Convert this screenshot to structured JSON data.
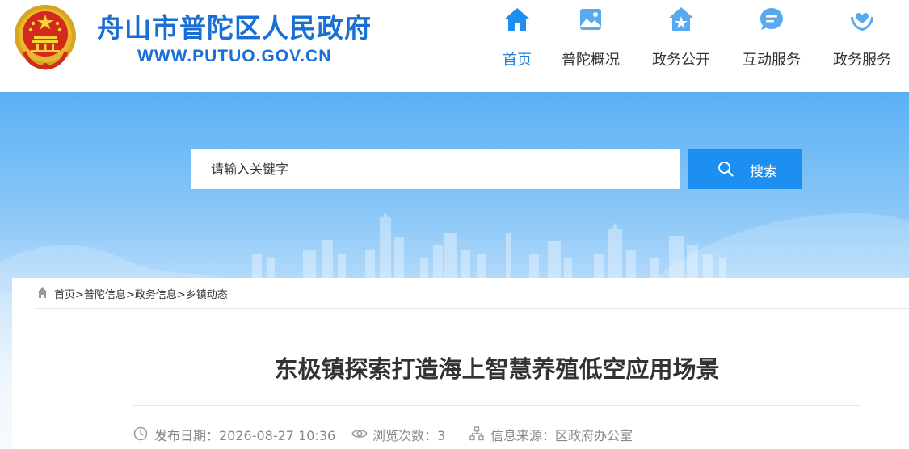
{
  "header": {
    "site_title": "舟山市普陀区人民政府",
    "site_url": "WWW.PUTUO.GOV.CN"
  },
  "nav": {
    "items": [
      {
        "label": "首页",
        "icon": "home-icon",
        "active": true
      },
      {
        "label": "普陀概况",
        "icon": "landscape-icon",
        "active": false
      },
      {
        "label": "政务公开",
        "icon": "star-house-icon",
        "active": false
      },
      {
        "label": "互动服务",
        "icon": "chat-bubble-icon",
        "active": false
      },
      {
        "label": "政务服务",
        "icon": "heart-hands-icon",
        "active": false
      }
    ]
  },
  "search": {
    "placeholder": "请输入关键字",
    "button_label": "搜索"
  },
  "breadcrumb": {
    "items": [
      "首页",
      "普陀信息",
      "政务信息",
      "乡镇动态"
    ],
    "separator": ">"
  },
  "article": {
    "title": "东极镇探索打造海上智慧养殖低空应用场景",
    "publish_label": "发布日期：2026-08-27 10:36",
    "views_label": "浏览次数：3",
    "source_label": "信息来源：区政府办公室"
  },
  "colors": {
    "brand_blue": "#1a6fd4",
    "nav_active": "#1a7fd8",
    "search_button": "#1d8ff0",
    "meta_gray": "#888888"
  }
}
